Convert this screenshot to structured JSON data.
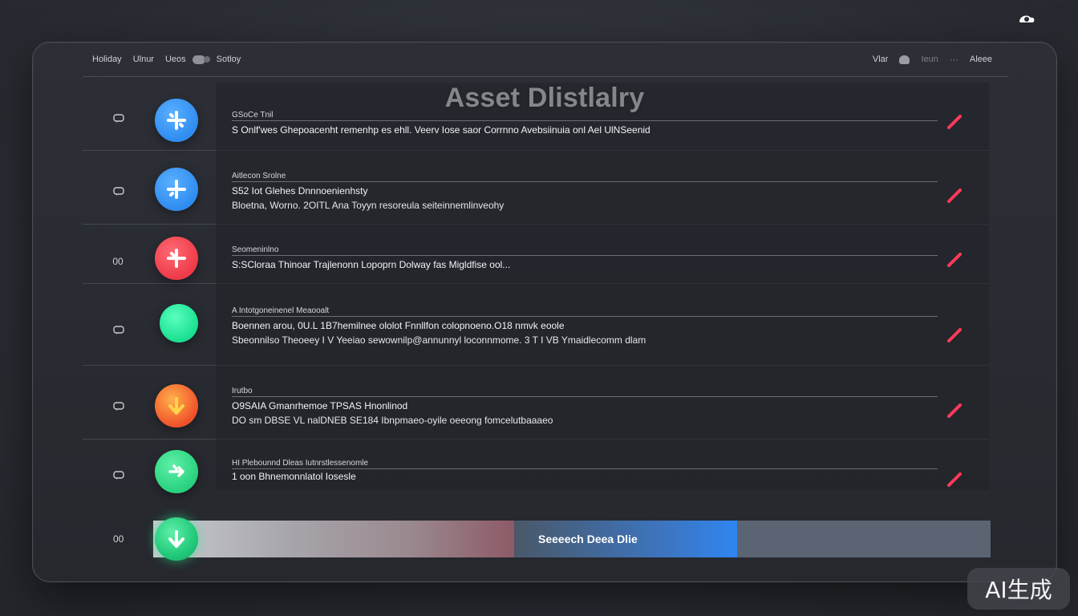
{
  "app": {
    "title": "Asset Dlistlalry",
    "watermark": "AI生成"
  },
  "topbar": {
    "nav": [
      "Holiday",
      "Ulnur",
      "Ueos",
      "Sotloy"
    ],
    "right": [
      "Vlar",
      "Ieun",
      "Aleee"
    ]
  },
  "rows": [
    {
      "lead": "",
      "icon": "chat-icon",
      "circle_color": "#2f8cf0",
      "circle_icon": "cross-icon",
      "line1": "GSoCe Tnil",
      "line2": "S Onlf'wes Ghepoacenht remenhp es ehll. Veerv Iose saor Corrnno Avebsiinuia onl Ael UlNSeenid",
      "line3": ""
    },
    {
      "lead": "",
      "icon": "chat-icon",
      "circle_color": "#2f8cf0",
      "circle_icon": "cross-icon",
      "line1": "Aitlecon Srolne",
      "line2": "S52 Iot Glehes Dnnnoenienhsty",
      "line3": "Bloetna, Worno. 2OITL  Ana Toyyn resoreula seiteinnemlinveohy"
    },
    {
      "lead": "00",
      "icon": "",
      "circle_color": "#ee3a48",
      "circle_icon": "cross-icon",
      "line1": "Seomeninlno",
      "line2": "S:SCloraa Thinoar Trajlenonn Lopoprn Dolway fas Migldfise ool...",
      "line3": ""
    },
    {
      "lead": "",
      "icon": "chat-icon",
      "circle_color": "#19e08f",
      "circle_icon": "",
      "line1": "A Intotgoneinenel Meaooalt",
      "line2": "Boennen arou, 0U.L 1B7hemilnee ololot Fnnllfon colopnoeno.O18 nmvk eoole",
      "line3": "Sbeonnilso Theoeey I V Yeeiao sewownilp@annunnyl loconnmome. 3 T I VB Ymaidlecomm dlam"
    },
    {
      "lead": "",
      "icon": "chat-icon",
      "circle_color": "#f0512a",
      "circle_icon": "arrow-down-icon",
      "line1": "Irutbo",
      "line2": "O9SAIA Gmanrhemoe TPSAS Hnonlinod",
      "line3": "DO sm DBSE VL nalDNEB SE184 Ibnpmaeo-oyile oeeong fomcelutbaaaeo"
    },
    {
      "lead": "",
      "icon": "chat-icon",
      "circle_color": "#29d17e",
      "circle_icon": "shuffle-icon",
      "line1": "HI  Plebounnd Dleas Iutnrstlessenomle",
      "line2": "1 oon Bhnemonnlatol Iosesle",
      "line3": ""
    }
  ],
  "searchbar": {
    "lead": "00",
    "label": "Seeeech Deea Dlie"
  },
  "colors": {
    "edit": "#ff3a5a",
    "accent_blue": "#2e86f0",
    "accent_green": "#22c97a"
  }
}
